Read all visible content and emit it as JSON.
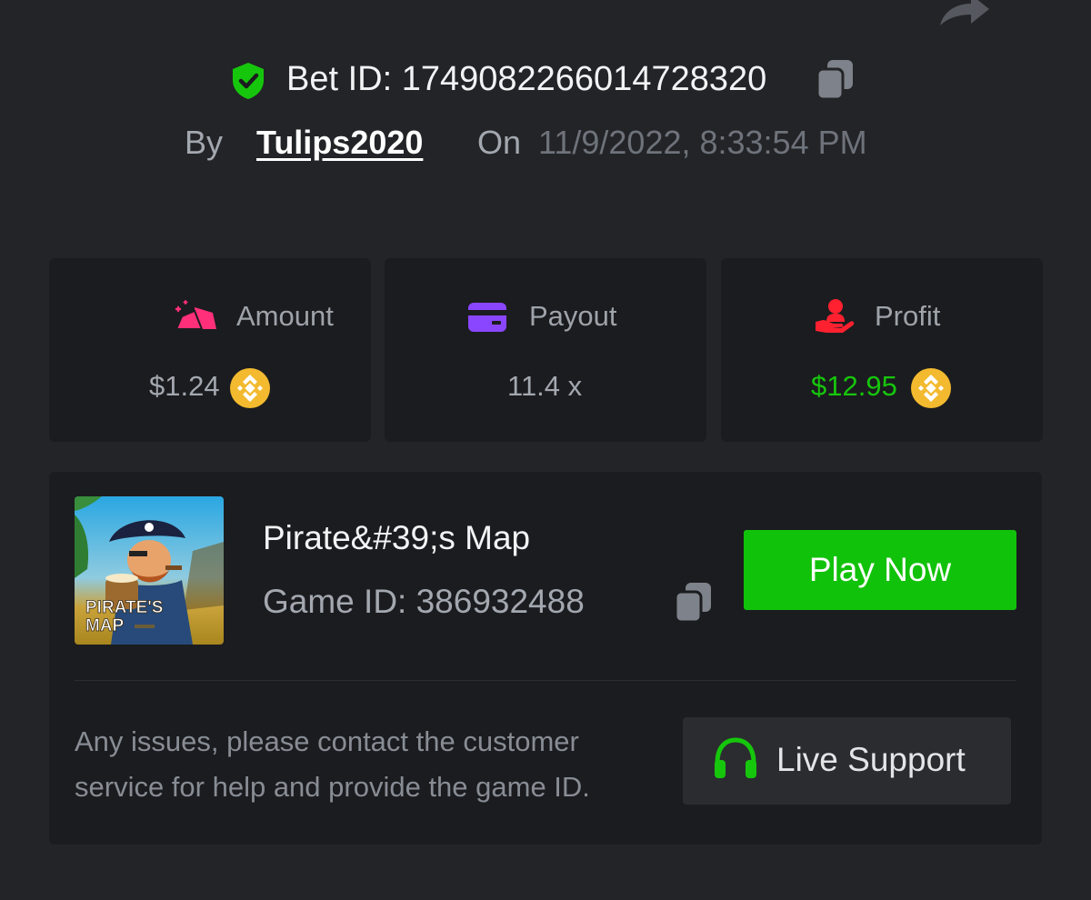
{
  "header": {
    "bet_id": "Bet ID: 1749082266014728320",
    "by_label": "By",
    "username": "Tulips2020",
    "on_label": "On",
    "date": "11/9/2022, 8:33:54 PM"
  },
  "stats": {
    "amount": {
      "label": "Amount",
      "value": "$1.24",
      "icon": "money-stack-icon",
      "icon_color": "#ff2f7a",
      "coin": "bnb-coin-icon"
    },
    "payout": {
      "label": "Payout",
      "value": "11.4 x",
      "icon": "card-icon",
      "icon_color": "#8a46ff"
    },
    "profit": {
      "label": "Profit",
      "value": "$12.95",
      "value_color": "#16c60c",
      "icon": "hand-user-icon",
      "icon_color": "#ff2130",
      "coin": "bnb-coin-icon"
    }
  },
  "game": {
    "name": "Pirate&#39;s Map",
    "game_id": "Game ID: 386932488",
    "thumbnail_text": [
      "PIRATE'S",
      "MAP"
    ],
    "play_label": "Play Now"
  },
  "support": {
    "help_text": "Any issues, please contact the customer service for help and provide the game ID.",
    "button_label": "Live Support"
  },
  "colors": {
    "background": "#232427",
    "card": "#1b1c1f",
    "accent_green": "#11c20a",
    "shield_green": "#16c60c",
    "coin_gold": "#f3ba2f"
  }
}
